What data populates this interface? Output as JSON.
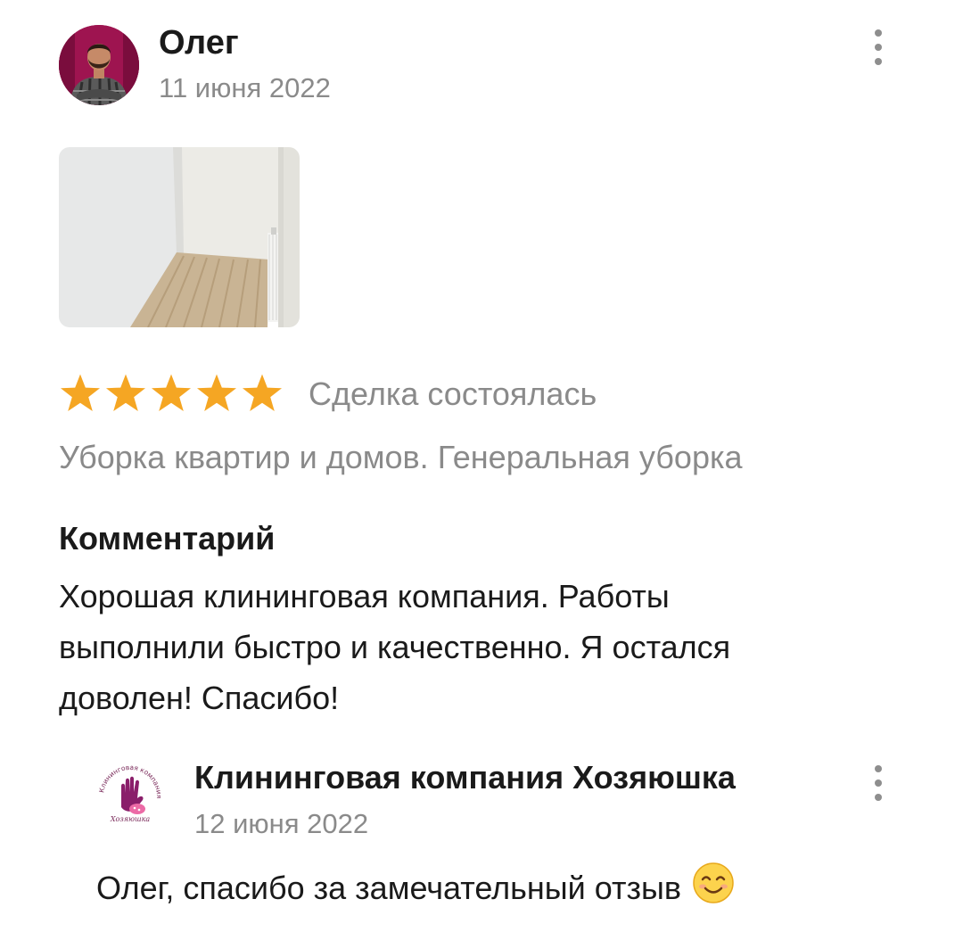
{
  "review": {
    "author_name": "Олег",
    "date": "11 июня 2022",
    "avatar_icon": "user-avatar-photo",
    "photo_icon": "room-photo-thumbnail",
    "rating": 5,
    "rating_max": 5,
    "star_color": "#f5a623",
    "deal_status": "Сделка состоялась",
    "service": "Уборка квартир и домов. Генеральная уборка",
    "comment_heading": "Комментарий",
    "comment_lines": [
      "Хорошая клининговая компания. Работы",
      "выполнили быстро и качественно. Я остался",
      "доволен! Спасибо!"
    ]
  },
  "reply": {
    "company_name": "Клининговая компания Хозяюшка",
    "logo_text_ring": "Клининговая компания",
    "logo_text_script": "Хозяюшка",
    "date": "12 июня 2022",
    "text": "Олег, спасибо за замечательный отзыв",
    "emoji_icon": "smiling-face-emoji"
  },
  "menu_icon": "more-vertical-icon"
}
